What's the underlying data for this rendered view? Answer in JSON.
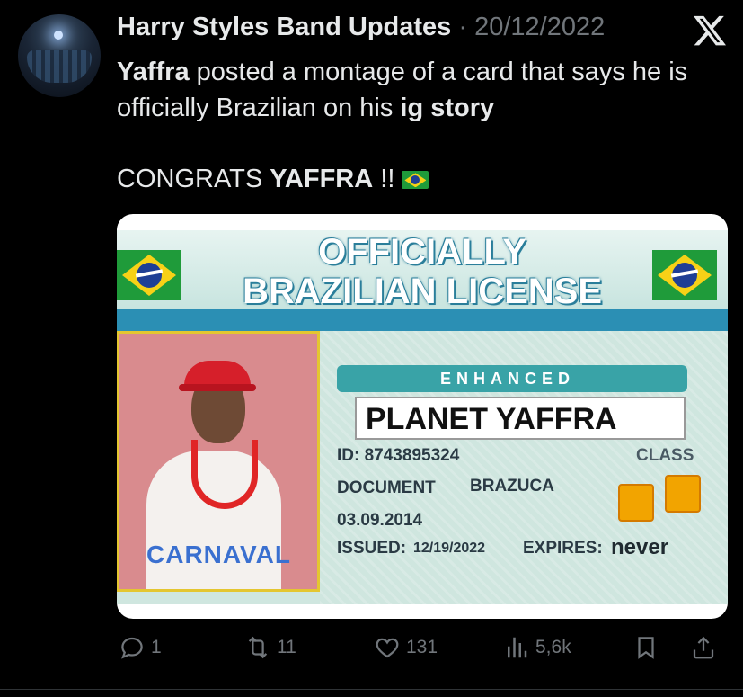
{
  "post": {
    "author": "Harry Styles Band Updates",
    "separator": "·",
    "date": "20/12/2022",
    "text_part1_bold": "Yaffra",
    "text_part1": " posted a montage of a card that says he is officially Brazilian on his ",
    "text_part1_end_bold": "ig story",
    "line2_prefix": "CONGRATS ",
    "line2_bold": "YAFFRA",
    "line2_suffix": " !! "
  },
  "card": {
    "title_line1": "OFFICIALLY",
    "title_line2": "BRAZILIAN LICENSE",
    "enhanced": "ENHANCED",
    "name": "PLANET YAFFRA",
    "id": "ID: 8743895324",
    "class": "CLASS",
    "document_label": "DOCUMENT",
    "document_value": "BRAZUCA",
    "dob": "03.09.2014",
    "issued_label": "ISSUED:",
    "issued_value": "12/19/2022",
    "expires_label": "EXPIRES:",
    "expires_value": "never",
    "carnaval": "CARNAVAL"
  },
  "actions": {
    "replies": "1",
    "reposts": "11",
    "likes": "131",
    "views": "5,6k"
  },
  "icons": [
    "x-logo-icon",
    "reply-icon",
    "repost-icon",
    "like-icon",
    "views-icon",
    "bookmark-icon",
    "share-icon"
  ]
}
